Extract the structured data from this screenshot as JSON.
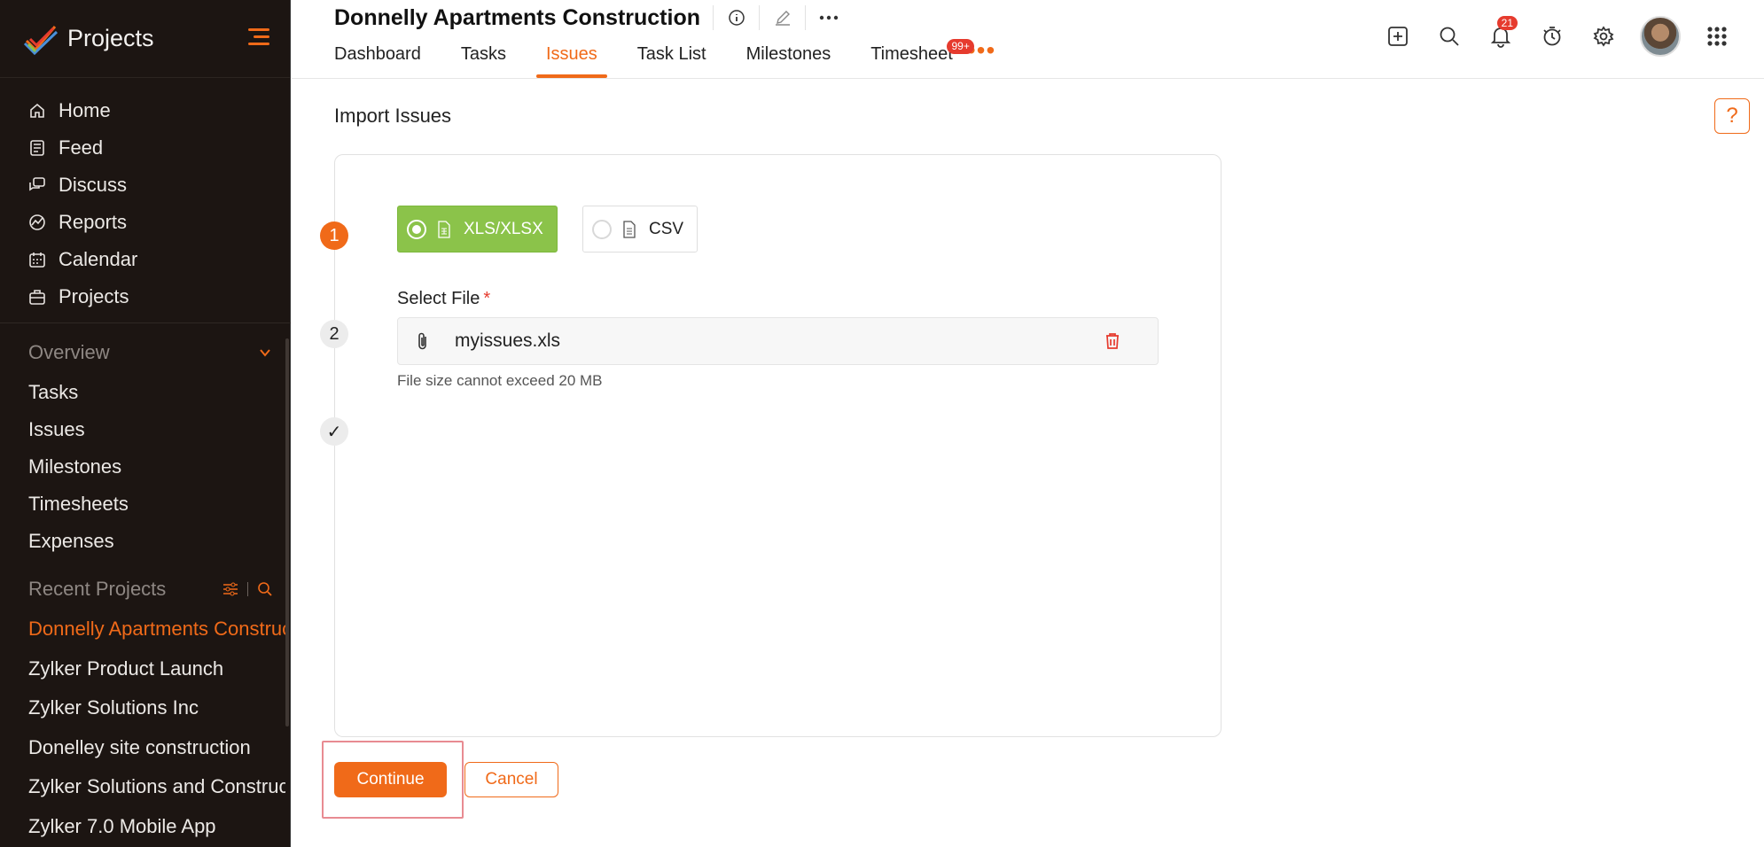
{
  "app": {
    "name": "Projects"
  },
  "sidebar": {
    "main_items": [
      {
        "label": "Home",
        "icon": "home-icon"
      },
      {
        "label": "Feed",
        "icon": "feed-icon"
      },
      {
        "label": "Discuss",
        "icon": "discuss-icon"
      },
      {
        "label": "Reports",
        "icon": "reports-icon"
      },
      {
        "label": "Calendar",
        "icon": "calendar-icon"
      },
      {
        "label": "Projects",
        "icon": "briefcase-icon"
      }
    ],
    "overview": {
      "title": "Overview",
      "items": [
        "Tasks",
        "Issues",
        "Milestones",
        "Timesheets",
        "Expenses"
      ]
    },
    "recent": {
      "title": "Recent Projects",
      "items": [
        "Donnelly Apartments Construction",
        "Zylker Product Launch",
        "Zylker Solutions Inc",
        "Donelley site construction",
        "Zylker Solutions and Construction",
        "Zylker 7.0 Mobile App"
      ]
    }
  },
  "header": {
    "project_title": "Donnelly Apartments Construction",
    "tabs": [
      "Dashboard",
      "Tasks",
      "Issues",
      "Task List",
      "Milestones",
      "Timesheet"
    ],
    "active_tab": "Issues",
    "timesheet_badge": "99+",
    "notification_count": "21"
  },
  "main": {
    "page_title": "Import Issues",
    "help_label": "?",
    "steps": {
      "one": "1",
      "two": "2",
      "three": "✓"
    },
    "formats": {
      "xls": "XLS/XLSX",
      "csv": "CSV",
      "selected": "XLS/XLSX"
    },
    "select_file_label": "Select File",
    "required_mark": "*",
    "file_name": "myissues.xls",
    "hint": "File size cannot exceed 20 MB",
    "continue_label": "Continue",
    "cancel_label": "Cancel"
  },
  "colors": {
    "accent": "#f06a19",
    "sidebar_bg": "#1c1512",
    "selected_format": "#8bc34a",
    "badge": "#e63b2e"
  }
}
